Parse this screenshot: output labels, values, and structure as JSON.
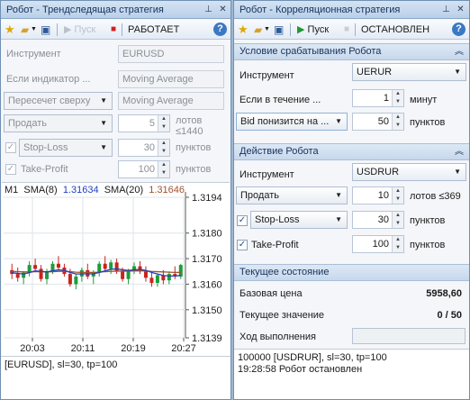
{
  "left": {
    "title": "Робот - Трендследящая стратегия",
    "toolbar": {
      "run": "Пуск",
      "state": "РАБОТАЕТ"
    },
    "instrument_label": "Инструмент",
    "instrument_value": "EURUSD",
    "if_indicator_label": "Если индикатор ...",
    "indicator_value": "Moving Average",
    "crossing_value": "Пересечет сверху",
    "indicator2_value": "Moving Average",
    "action_value": "Продать",
    "lots_value": "5",
    "lots_unit": "лотов",
    "lots_limit": "≤1440",
    "stoploss_label": "Stop-Loss",
    "stoploss_value": "30",
    "stoploss_unit": "пунктов",
    "takeprofit_label": "Take-Profit",
    "takeprofit_value": "100",
    "takeprofit_unit": "пунктов",
    "status": "[EURUSD], sl=30, tp=100"
  },
  "right": {
    "title": "Робот - Корреляционная стратегия",
    "toolbar": {
      "run": "Пуск",
      "state": "ОСТАНОВЛЕН"
    },
    "condition_header": "Условие срабатывания Робота",
    "instrument_label": "Инструмент",
    "instrument_value": "UERUR",
    "if_within_label": "Если в течение ...",
    "minutes_value": "1",
    "minutes_unit": "минут",
    "bid_value": "Bid понизится на ...",
    "points_value": "50",
    "points_unit": "пунктов",
    "action_header": "Действие Робота",
    "instrument2_label": "Инструмент",
    "instrument2_value": "USDRUR",
    "action_value": "Продать",
    "lots_value": "10",
    "lots_unit": "лотов ≤369",
    "stoploss_label": "Stop-Loss",
    "stoploss_value": "30",
    "stoploss_unit": "пунктов",
    "takeprofit_label": "Take-Profit",
    "takeprofit_value": "100",
    "takeprofit_unit": "пунктов",
    "state_header": "Текущее состояние",
    "base_price_label": "Базовая цена",
    "base_price_value": "5958,60",
    "current_value_label": "Текущее значение",
    "current_value": "0 / 50",
    "progress_label": "Ход выполнения",
    "progress_fraction": 0.0,
    "log_line1": "100000 [USDRUR], sl=30, tp=100",
    "log_line2": "19:28:58 Робот остановлен"
  },
  "chart_data": {
    "type": "candlestick",
    "timeframe": "M1",
    "legend": [
      {
        "name": "SMA(8)",
        "value": "1.31634",
        "color": "#1f3fbf"
      },
      {
        "name": "SMA(20)",
        "value": "1.31646",
        "color": "#a0522d"
      }
    ],
    "y_ticks": [
      "1.3194",
      "1.3180",
      "1.3170",
      "1.3160",
      "1.3150",
      "1.3139"
    ],
    "y_range": [
      1.3139,
      1.3194
    ],
    "x_ticks": [
      "20:03",
      "20:11",
      "20:19",
      "20:27"
    ],
    "candles": [
      [
        1.31655,
        1.3168,
        1.3162,
        1.3164
      ],
      [
        1.3164,
        1.31665,
        1.3161,
        1.31625
      ],
      [
        1.31625,
        1.3165,
        1.316,
        1.31645
      ],
      [
        1.31645,
        1.3169,
        1.3163,
        1.31675
      ],
      [
        1.31675,
        1.317,
        1.3165,
        1.3166
      ],
      [
        1.3166,
        1.31675,
        1.3161,
        1.3162
      ],
      [
        1.3162,
        1.3166,
        1.316,
        1.3165
      ],
      [
        1.3165,
        1.3169,
        1.3164,
        1.3168
      ],
      [
        1.3168,
        1.3171,
        1.31655,
        1.31665
      ],
      [
        1.31665,
        1.3168,
        1.3163,
        1.3164
      ],
      [
        1.3164,
        1.3166,
        1.3159,
        1.316
      ],
      [
        1.316,
        1.3164,
        1.3158,
        1.3163
      ],
      [
        1.3163,
        1.31665,
        1.3161,
        1.31655
      ],
      [
        1.31655,
        1.3168,
        1.3162,
        1.3163
      ],
      [
        1.3163,
        1.31655,
        1.316,
        1.31645
      ],
      [
        1.31645,
        1.3169,
        1.3163,
        1.3168
      ],
      [
        1.3168,
        1.3171,
        1.3165,
        1.3166
      ],
      [
        1.3166,
        1.31695,
        1.3164,
        1.31685
      ],
      [
        1.31685,
        1.317,
        1.3164,
        1.3165
      ],
      [
        1.3165,
        1.31665,
        1.3161,
        1.3162
      ],
      [
        1.3162,
        1.3166,
        1.316,
        1.31655
      ],
      [
        1.31655,
        1.31685,
        1.3164,
        1.3167
      ],
      [
        1.3167,
        1.3169,
        1.3164,
        1.3165
      ],
      [
        1.3165,
        1.3167,
        1.3161,
        1.31625
      ],
      [
        1.31625,
        1.3165,
        1.3159,
        1.31605
      ],
      [
        1.31605,
        1.3164,
        1.3159,
        1.31635
      ],
      [
        1.31635,
        1.31655,
        1.316,
        1.31615
      ],
      [
        1.31615,
        1.3165,
        1.316,
        1.3164
      ],
      [
        1.3164,
        1.3167,
        1.3162,
        1.3163
      ],
      [
        1.3163,
        1.3168,
        1.3162,
        1.31675
      ]
    ],
    "sma8": [
      1.31645,
      1.31642,
      1.3164,
      1.31645,
      1.31652,
      1.3165,
      1.31648,
      1.31652,
      1.31656,
      1.31654,
      1.31646,
      1.3164,
      1.3164,
      1.31641,
      1.3164,
      1.31646,
      1.31652,
      1.31658,
      1.3166,
      1.31656,
      1.31654,
      1.31656,
      1.31658,
      1.31654,
      1.31646,
      1.3164,
      1.31634,
      1.31632,
      1.31632,
      1.31634
    ],
    "sma20": [
      1.3165,
      1.31649,
      1.31648,
      1.31648,
      1.31649,
      1.31649,
      1.31648,
      1.31649,
      1.3165,
      1.3165,
      1.31649,
      1.31647,
      1.31646,
      1.31646,
      1.31646,
      1.31647,
      1.31649,
      1.3165,
      1.31651,
      1.31651,
      1.31651,
      1.31652,
      1.31652,
      1.31652,
      1.3165,
      1.31649,
      1.31648,
      1.31647,
      1.31646,
      1.31646
    ],
    "colors": {
      "up": "#1e9c3a",
      "down": "#c8241c"
    }
  },
  "colors": {
    "accent": "#b9cfe9",
    "section": "#c7d8ec",
    "progress": "#7ea9d8"
  }
}
